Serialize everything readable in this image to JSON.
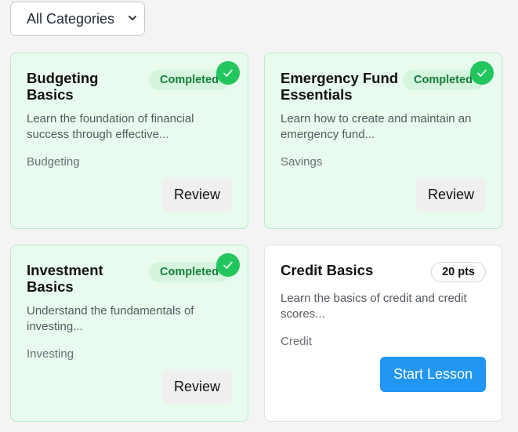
{
  "filter": {
    "selected": "All Categories"
  },
  "lessons": [
    {
      "title": "Budgeting Basics",
      "description": "Learn the foundation of financial success through effective...",
      "category": "Budgeting",
      "status": "Completed",
      "action": "Review"
    },
    {
      "title": "Emergency Fund Essentials",
      "description": "Learn how to create and maintain an emergency fund...",
      "category": "Savings",
      "status": "Completed",
      "action": "Review"
    },
    {
      "title": "Investment Basics",
      "description": "Understand the fundamentals of investing...",
      "category": "Investing",
      "status": "Completed",
      "action": "Review"
    },
    {
      "title": "Credit Basics",
      "description": "Learn the basics of credit and credit scores...",
      "category": "Credit",
      "points": "20 pts",
      "action": "Start Lesson"
    }
  ],
  "icons": {
    "completed": "check-icon",
    "dropdown": "chevron-down-icon"
  },
  "colors": {
    "completed_card_bg": "#e8fbee",
    "completed_badge_text": "#15803d",
    "check_circle": "#22c55e",
    "primary_button": "#2196f3"
  }
}
